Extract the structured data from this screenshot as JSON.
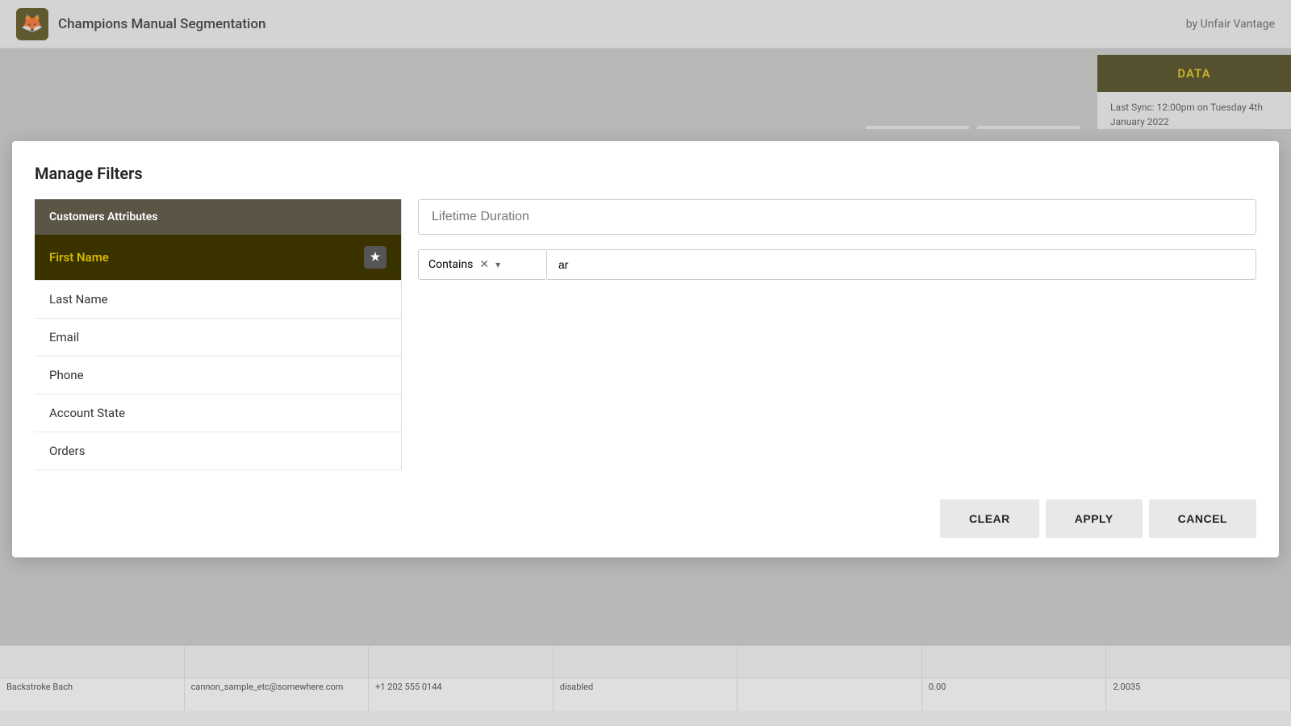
{
  "app": {
    "logo_emoji": "🦊",
    "title": "Champions Manual Segmentation",
    "by_label": "by Unfair Vantage"
  },
  "data_panel": {
    "button_label": "DATA",
    "sync_label": "Last Sync: 12:00pm on Tuesday 4th January 2022"
  },
  "modal": {
    "title": "Manage Filters",
    "filter_name_placeholder": "Lifetime Duration",
    "category": {
      "label": "Customers Attributes"
    },
    "filter_items": [
      {
        "label": "First Name",
        "active": true
      },
      {
        "label": "Last Name",
        "active": false
      },
      {
        "label": "Email",
        "active": false
      },
      {
        "label": "Phone",
        "active": false
      },
      {
        "label": "Account State",
        "active": false
      },
      {
        "label": "Orders",
        "active": false
      }
    ],
    "condition": {
      "operator": "Contains",
      "value": "ar"
    },
    "buttons": {
      "clear": "CLEAR",
      "apply": "APPLY",
      "cancel": "CANCEL"
    }
  },
  "table": {
    "row_data": [
      "Backstroke Bach",
      "cannon_sample_etc@somewhere.com",
      "+1 202 555 0144",
      "disabled",
      "",
      "0.00",
      "2.0035"
    ]
  }
}
